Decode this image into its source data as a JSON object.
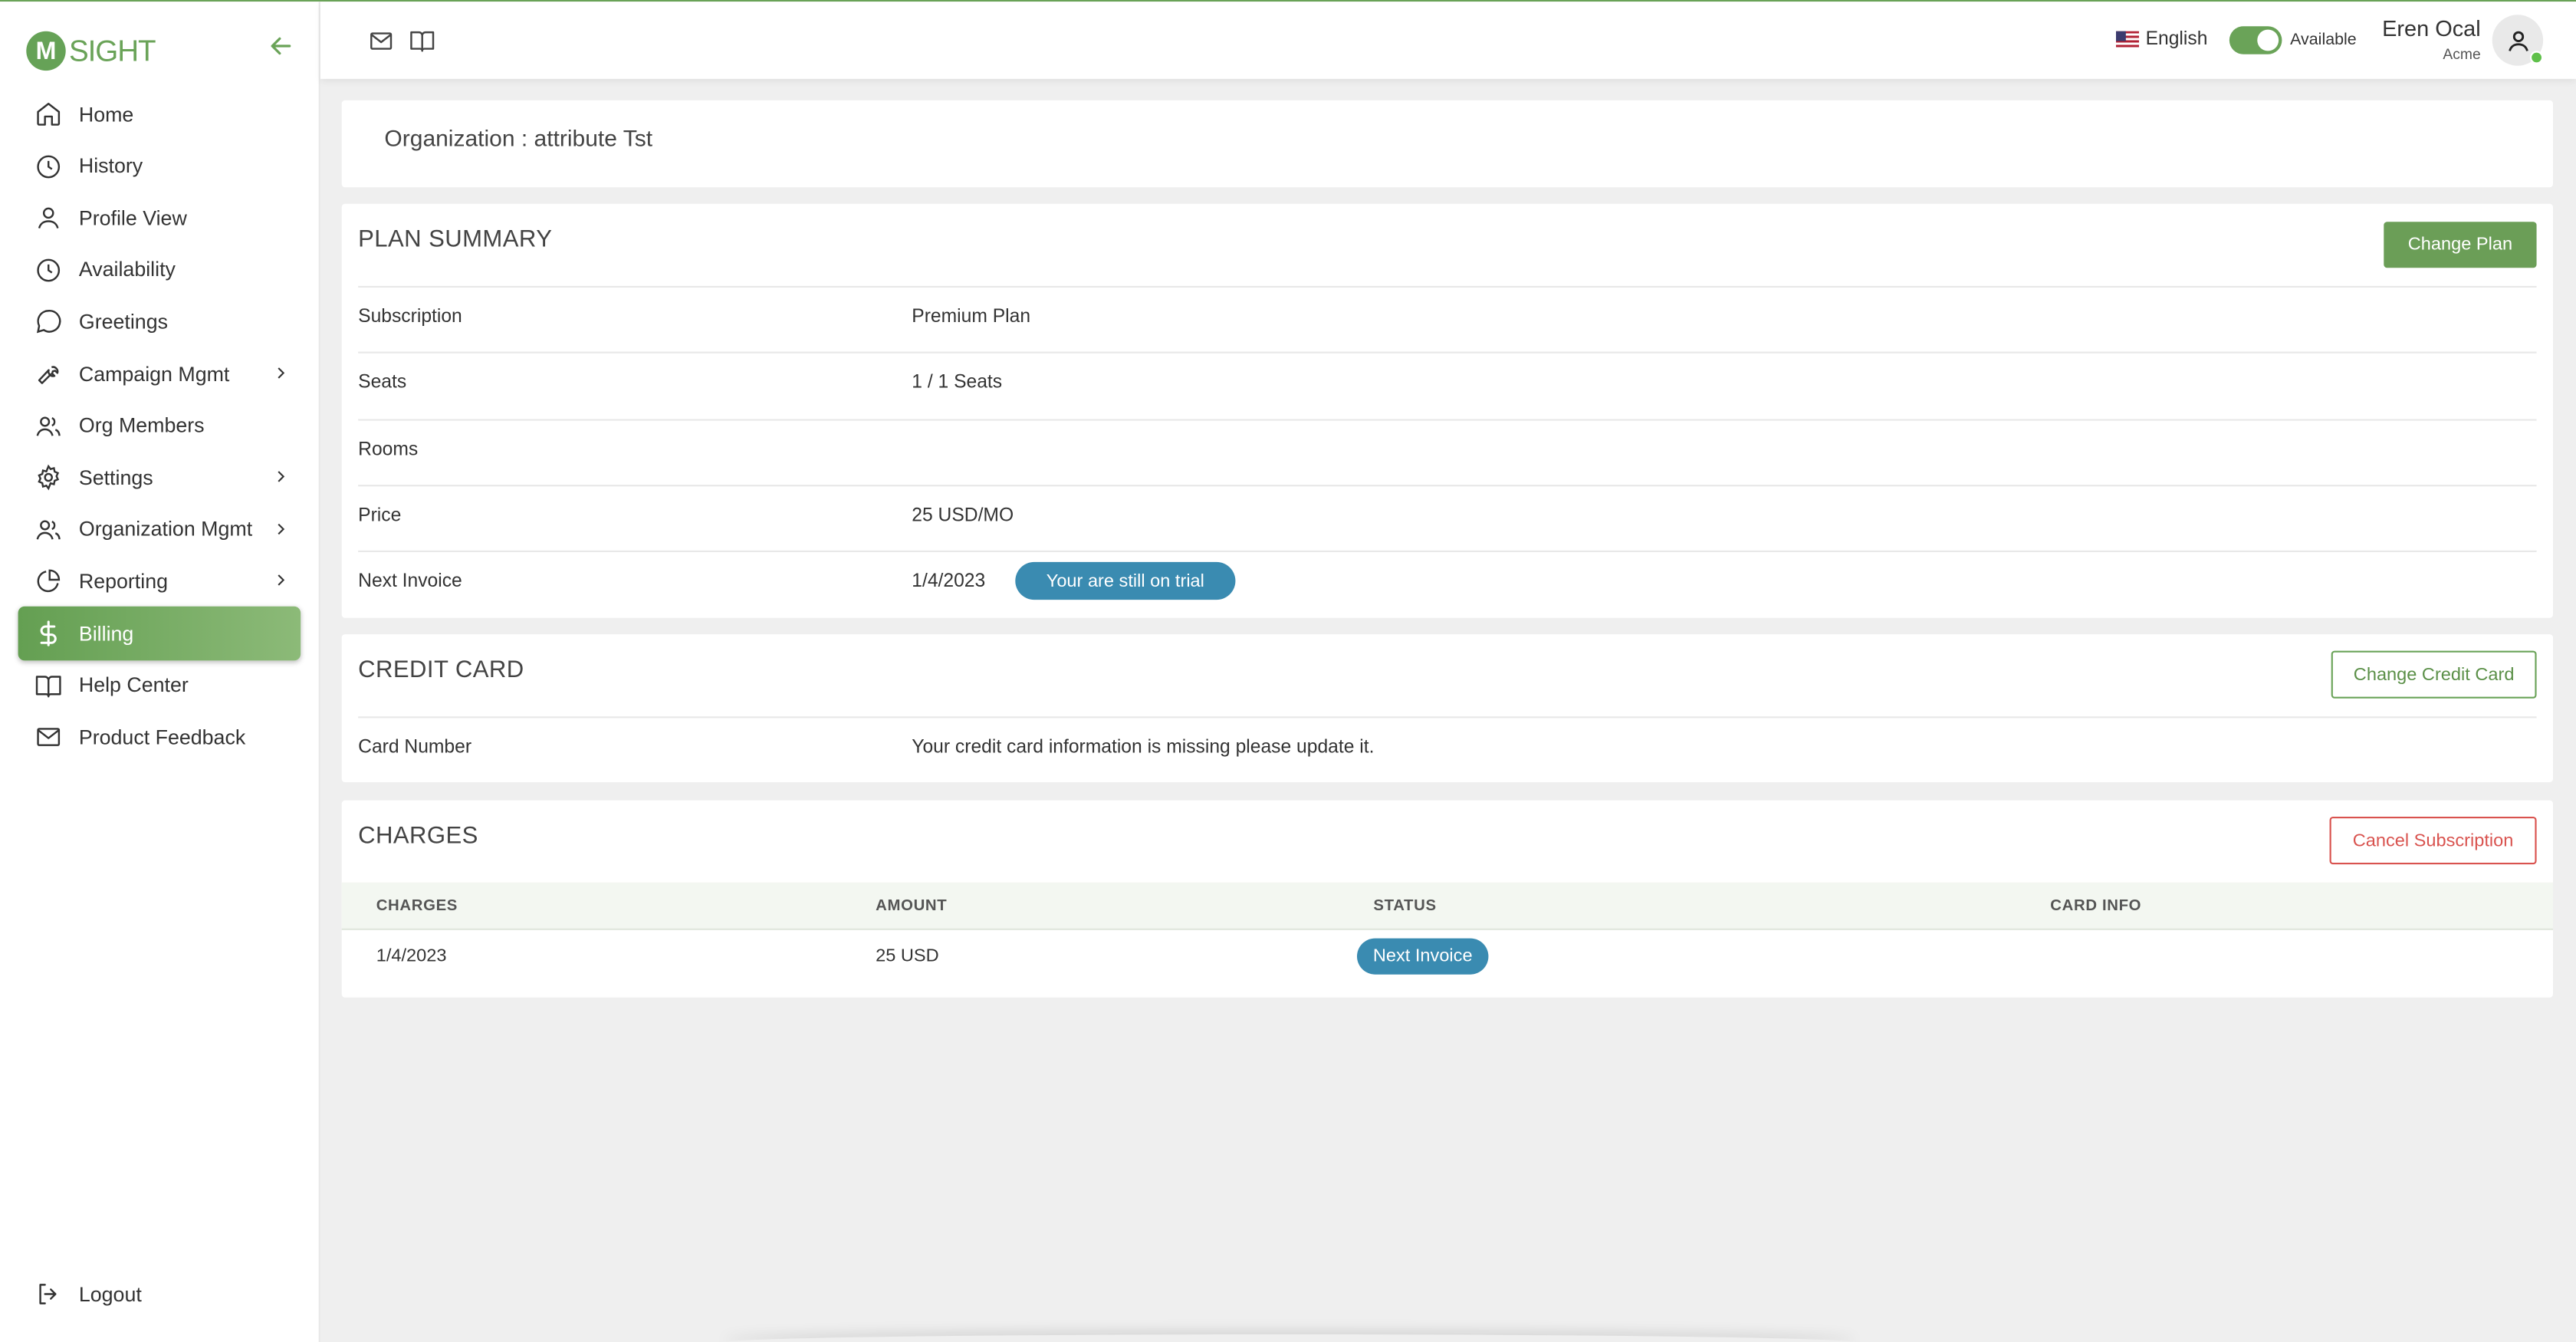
{
  "app": {
    "logo_text": "SIGHT",
    "logo_letter": "M"
  },
  "sidebar": {
    "items": [
      {
        "label": "Home",
        "icon": "home-icon"
      },
      {
        "label": "History",
        "icon": "clock-icon"
      },
      {
        "label": "Profile View",
        "icon": "user-icon"
      },
      {
        "label": "Availability",
        "icon": "clock-icon"
      },
      {
        "label": "Greetings",
        "icon": "chat-bubble-icon"
      },
      {
        "label": "Campaign Mgmt",
        "icon": "wrench-icon",
        "has_submenu": true
      },
      {
        "label": "Org Members",
        "icon": "users-icon"
      },
      {
        "label": "Settings",
        "icon": "gear-icon",
        "has_submenu": true
      },
      {
        "label": "Organization Mgmt",
        "icon": "users-icon",
        "has_submenu": true
      },
      {
        "label": "Reporting",
        "icon": "pie-chart-icon",
        "has_submenu": true
      },
      {
        "label": "Billing",
        "icon": "dollar-icon",
        "active": true
      },
      {
        "label": "Help Center",
        "icon": "book-icon"
      },
      {
        "label": "Product Feedback",
        "icon": "mail-icon"
      }
    ],
    "logout_label": "Logout"
  },
  "topbar": {
    "language": "English",
    "availability_label": "Available",
    "availability_on": true,
    "user_name": "Eren Ocal",
    "user_org": "Acme"
  },
  "org": {
    "title": "Organization : attribute Tst"
  },
  "plan_summary": {
    "title": "PLAN SUMMARY",
    "change_plan_label": "Change Plan",
    "rows": [
      {
        "label": "Subscription",
        "value": "Premium Plan"
      },
      {
        "label": "Seats",
        "value": "1 / 1 Seats"
      },
      {
        "label": "Rooms",
        "value": ""
      },
      {
        "label": "Price",
        "value": "25 USD/MO"
      },
      {
        "label": "Next Invoice",
        "value": "1/4/2023"
      }
    ],
    "trial_badge": "Your are still on trial"
  },
  "credit_card": {
    "title": "CREDIT CARD",
    "change_label": "Change Credit Card",
    "card_label": "Card Number",
    "card_value": "Your credit card information is missing please update it."
  },
  "charges": {
    "title": "CHARGES",
    "cancel_label": "Cancel Subscription",
    "columns": [
      "CHARGES",
      "AMOUNT",
      "STATUS",
      "CARD INFO"
    ],
    "rows": [
      {
        "charge": "1/4/2023",
        "amount": "25 USD",
        "status": "Next Invoice",
        "card_info": ""
      }
    ]
  },
  "colors": {
    "accent": "#6aa358",
    "badge": "#3a8bb1",
    "danger": "#d9534f"
  }
}
